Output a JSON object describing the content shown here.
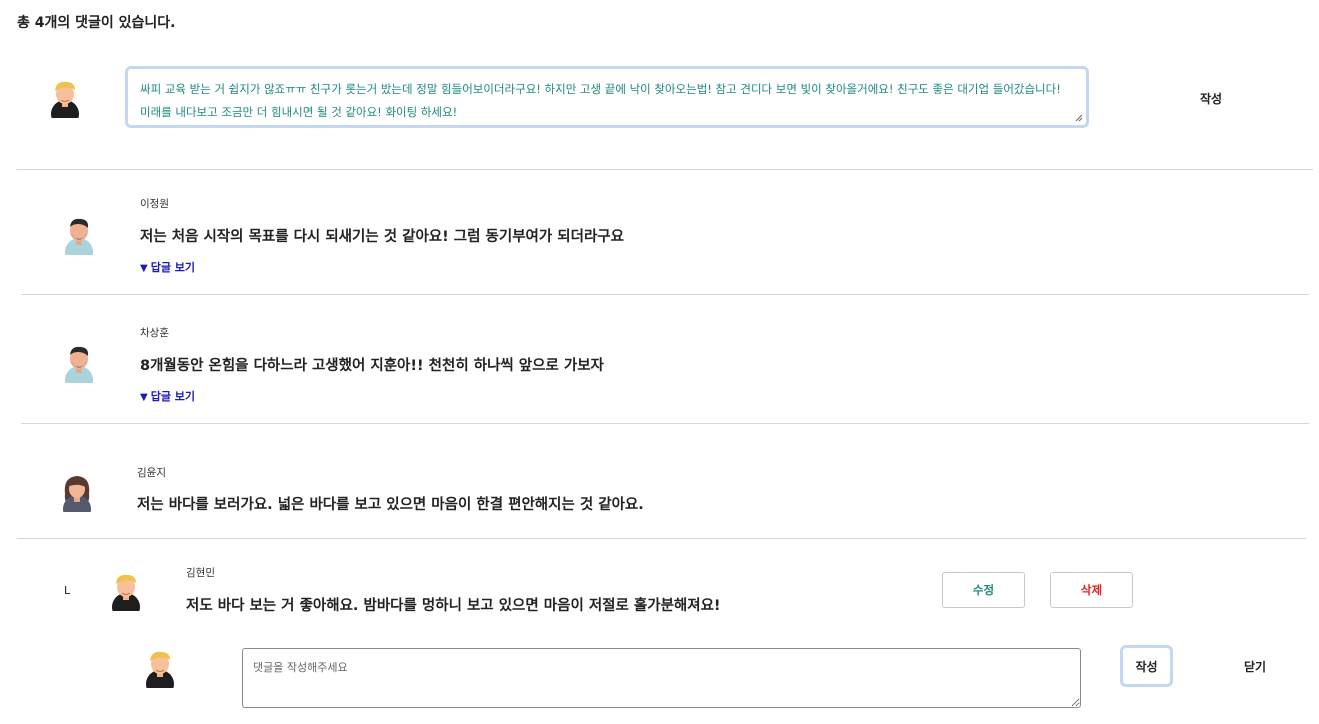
{
  "total_comments_label": "총 4개의 댓글이 있습니다.",
  "composer": {
    "text": "싸피 교육 받는 거 쉽지가 않죠ㅠㅠ 친구가 롯는거 밨는데 정말 힘들어보이더라구요! 하지만 고생 끝에 낙이 찾아오는법! 참고 견디다 보면 빛이 찾아올거에요! 친구도 좋은 대기업 들어갔습니다! 미래를 내다보고 조금만 더 힘내시면 될 것 같아요! 화이팅 하세요!",
    "submit_label": "작성"
  },
  "comments": [
    {
      "author": "이정원",
      "text": "저는 처음 시작의 목표를 다시 되새기는 것 같아요! 그럼 동기부여가 되더라구요",
      "toggle": "답글 보기"
    },
    {
      "author": "차상훈",
      "text": "8개월동안 온힘을 다하느라 고생했어 지훈아!! 천천히 하나씩 앞으로 가보자",
      "toggle": "답글 보기"
    },
    {
      "author": "김윤지",
      "text": "저는 바다를 보러가요. 넓은 바다를 보고 있으면 마음이 한결 편안해지는 것 같아요."
    }
  ],
  "reply": {
    "marker": "L",
    "author": "김현민",
    "text": "저도 바다 보는 거 좋아해요. 밤바다를 멍하니 보고 있으면 마음이 저절로 홀가분해져요!",
    "edit_label": "수정",
    "delete_label": "삭제"
  },
  "reply_composer": {
    "placeholder": "댓글을 작성해주세요",
    "submit_label": "작성",
    "close_label": "닫기"
  },
  "colors": {
    "accent_teal": "#1d8a7c",
    "link_blue": "#1a1ab8",
    "delete_red": "#e02020",
    "focus_ring": "#c3d7f3"
  },
  "icons": {
    "toggle": "triangle-down-icon",
    "avatar": "user-avatar-icon"
  }
}
